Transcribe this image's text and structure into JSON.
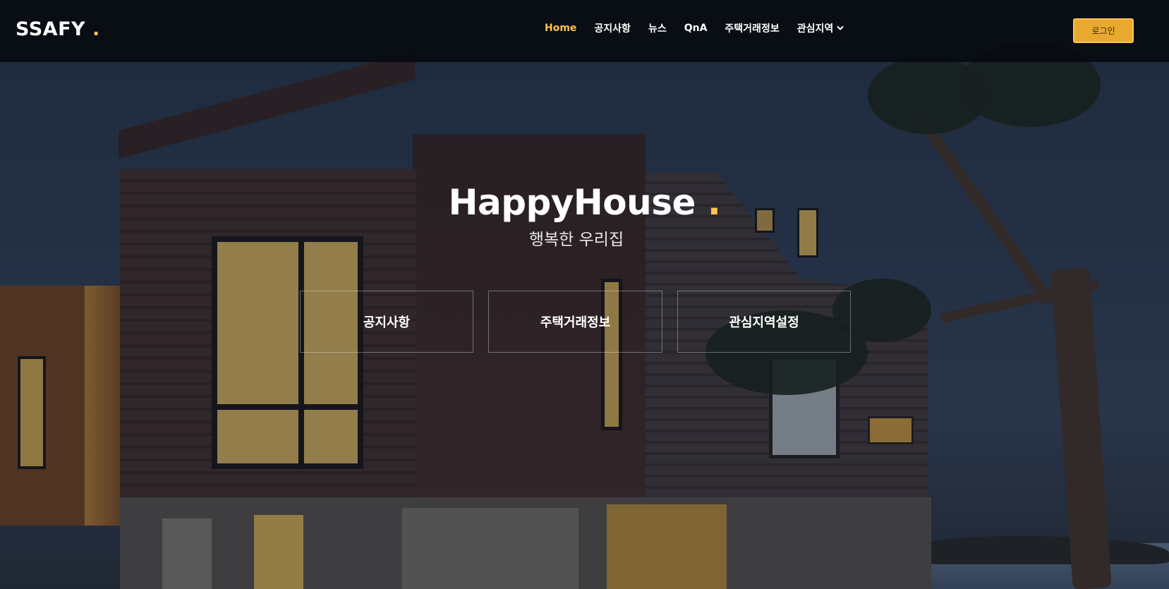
{
  "header": {
    "logo_text": "SSAFY",
    "logo_dot": ".",
    "nav": [
      {
        "label": "Home",
        "active": true
      },
      {
        "label": "공지사항"
      },
      {
        "label": "뉴스"
      },
      {
        "label": "QnA"
      },
      {
        "label": "주택거래정보"
      },
      {
        "label": "관심지역",
        "has_dropdown": true
      }
    ],
    "login_label": "로그인"
  },
  "hero": {
    "title": "HappyHouse",
    "title_dot": ".",
    "subtitle": "행복한 우리집",
    "boxes": [
      {
        "label": "공지사항"
      },
      {
        "label": "주택거래정보"
      },
      {
        "label": "관심지역설정"
      }
    ]
  },
  "colors": {
    "accent": "#ffc451",
    "header_bg": "#080b11",
    "login_bg": "#e7a92f"
  },
  "icons": {
    "dropdown": "chevron-down-icon"
  }
}
